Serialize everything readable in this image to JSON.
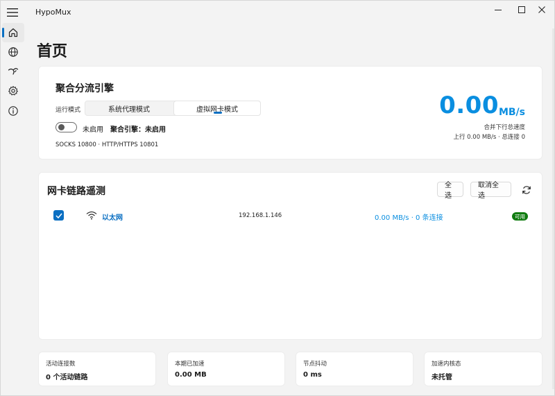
{
  "app": {
    "title": "HypoMux"
  },
  "window_controls": [
    "minimize",
    "maximize",
    "close"
  ],
  "nav": {
    "items": [
      {
        "icon": "home-icon",
        "active": true
      },
      {
        "icon": "globe-icon",
        "active": false
      },
      {
        "icon": "speed-icon",
        "active": false
      },
      {
        "icon": "gear-icon",
        "active": false
      },
      {
        "icon": "info-icon",
        "active": false
      }
    ]
  },
  "page": {
    "title": "首页"
  },
  "engine": {
    "title": "聚合分流引擎",
    "mode_label": "运行模式",
    "modes": [
      "系统代理模式",
      "虚拟网卡模式"
    ],
    "selected_mode": "虚拟网卡模式",
    "toggle_label": "未启用",
    "status_text": "聚合引擎：未启用",
    "ports": "SOCKS 10800 · HTTP/HTTPS 10801",
    "speed_value": "0.00",
    "speed_unit": "MB/s",
    "speed_caption": "合并下行总速度",
    "speed_detail": "上行 0.00 MB/s · 总连接 0"
  },
  "telemetry": {
    "title": "网卡链路遥测",
    "select_all": "全选",
    "deselect_all": "取消全选",
    "adapters": [
      {
        "name": "以太网",
        "ip": "192.168.1.146",
        "stats": "0.00 MB/s · 0 条连接",
        "badge": "可用",
        "checked": true
      }
    ]
  },
  "stats": [
    {
      "label": "活动连接数",
      "value": "0 个活动链路"
    },
    {
      "label": "本期已加速",
      "value": "0.00 MB"
    },
    {
      "label": "节点抖动",
      "value": "0 ms"
    },
    {
      "label": "加速内核态",
      "value": "未托管"
    }
  ],
  "colors": {
    "accent": "#0a6fc2",
    "speed": "#0a8ee0",
    "available_badge": "#107c10"
  }
}
